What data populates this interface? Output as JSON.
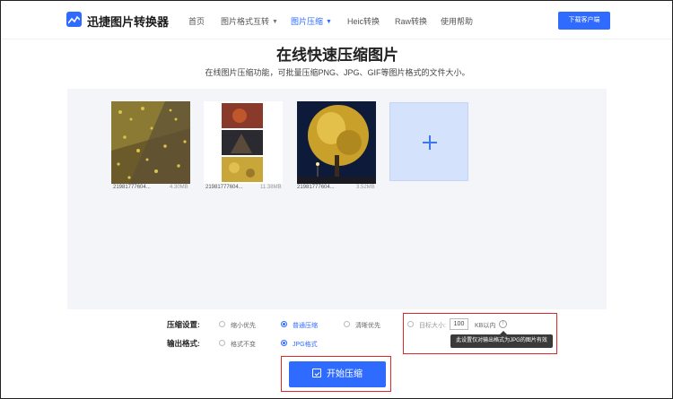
{
  "header": {
    "brand": "迅捷图片转换器",
    "nav": [
      {
        "label": "首页",
        "dropdown": false,
        "active": false
      },
      {
        "label": "图片格式互转",
        "dropdown": true,
        "active": false
      },
      {
        "label": "图片压缩",
        "dropdown": true,
        "active": true
      },
      {
        "label": "Heic转换",
        "dropdown": false,
        "active": false
      },
      {
        "label": "Raw转换",
        "dropdown": false,
        "active": false
      },
      {
        "label": "使用帮助",
        "dropdown": false,
        "active": false
      }
    ],
    "download_label": "下载客户端"
  },
  "main": {
    "title": "在线快速压缩图片",
    "subtitle": "在线图片压缩功能，可批量压缩PNG、JPG、GIF等图片格式的文件大小。"
  },
  "files": [
    {
      "name": "21981777604...",
      "size": "4.30MB"
    },
    {
      "name": "21981777604...",
      "size": "11.38MB"
    },
    {
      "name": "21981777604...",
      "size": "3.52MB"
    }
  ],
  "settings": {
    "compress_label": "压缩设置:",
    "compress_options": [
      {
        "label": "缩小优先",
        "checked": false
      },
      {
        "label": "普通压缩",
        "checked": true
      },
      {
        "label": "清晰优先",
        "checked": false
      }
    ],
    "target_label": "目标大小:",
    "target_value": "100",
    "target_unit": "KB以内",
    "info_glyph": "!",
    "tooltip": "此设置仅对输出格式为JPG的图片有效",
    "output_label": "输出格式:",
    "output_options": [
      {
        "label": "格式不变",
        "checked": false
      },
      {
        "label": "JPG格式",
        "checked": true
      }
    ]
  },
  "actions": {
    "start_label": "开始压缩"
  },
  "colors": {
    "accent": "#2f6bff",
    "highlight_border": "#e02828",
    "upload_bg": "#f3f5f8",
    "add_tile": "#d5e2fb"
  }
}
